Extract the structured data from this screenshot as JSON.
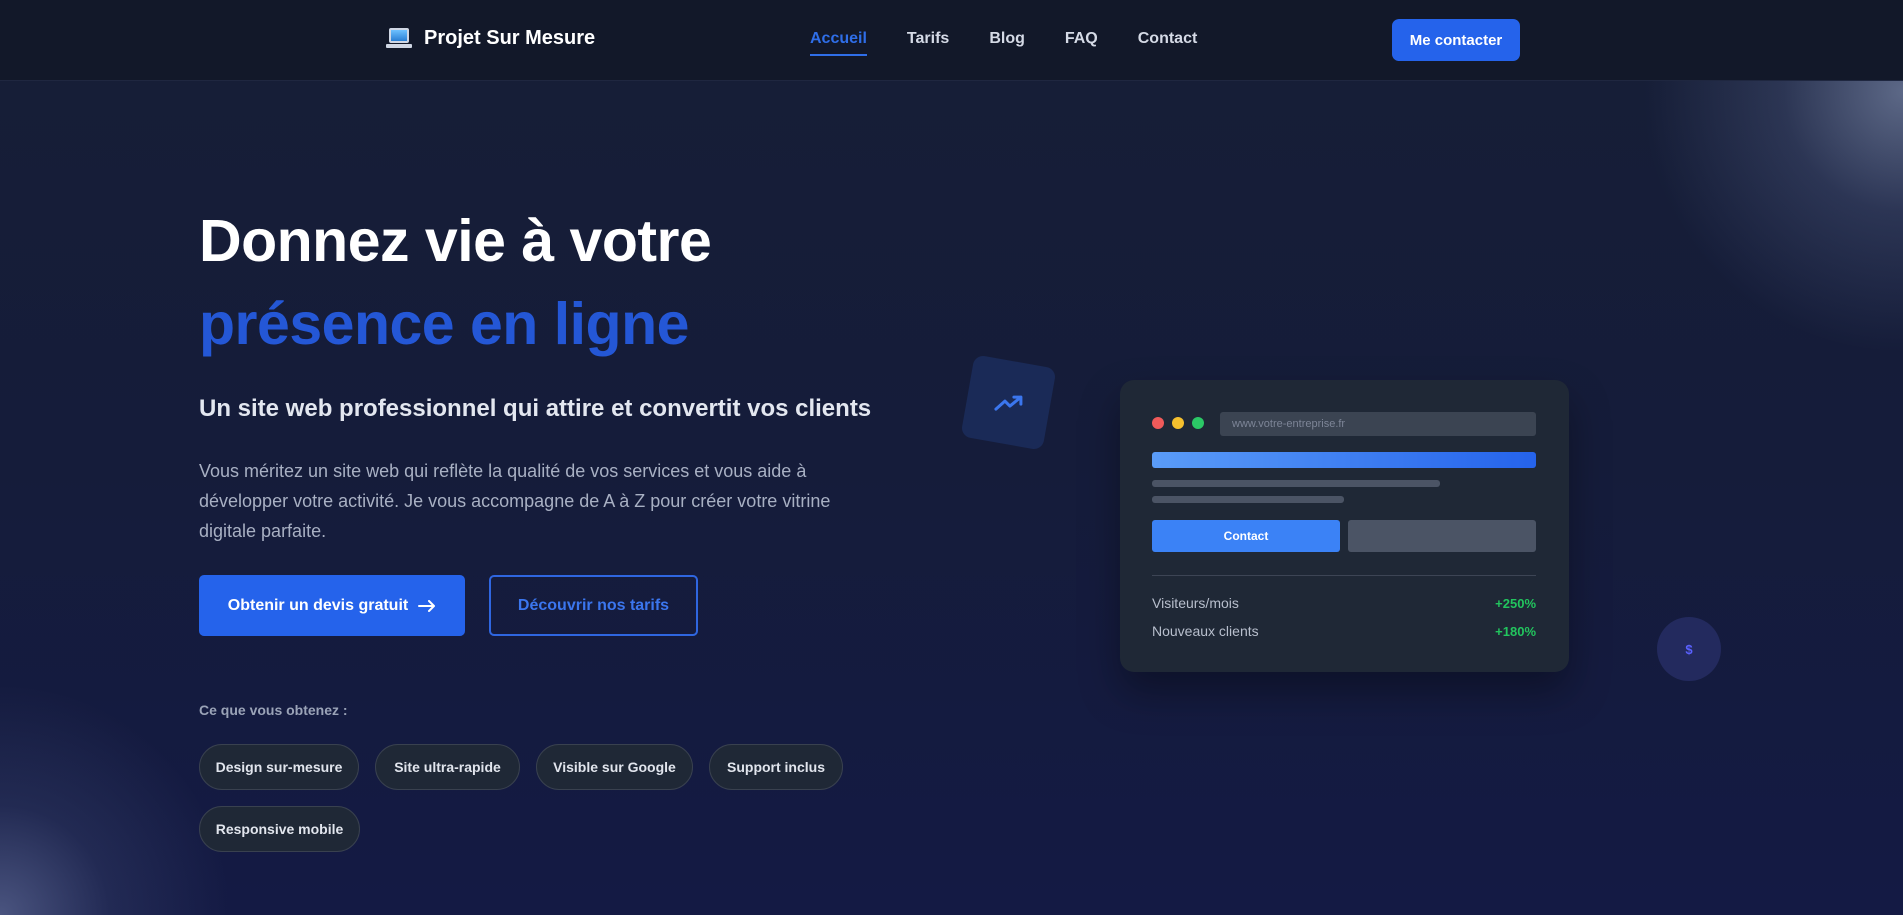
{
  "brand": {
    "name": "Projet Sur Mesure",
    "icon": "laptop-icon"
  },
  "nav": {
    "items": [
      {
        "label": "Accueil",
        "active": true
      },
      {
        "label": "Tarifs",
        "active": false
      },
      {
        "label": "Blog",
        "active": false
      },
      {
        "label": "FAQ",
        "active": false
      },
      {
        "label": "Contact",
        "active": false
      }
    ],
    "cta_label": "Me contacter"
  },
  "hero": {
    "title_line1": "Donnez vie à votre",
    "title_line2": "présence en ligne",
    "subtitle": "Un site web professionnel qui attire et convertit vos clients",
    "description": "Vous méritez un site web qui reflète la qualité de vos services et vous aide à développer votre activité. Je vous accompagne de A à Z pour créer votre vitrine digitale parfaite.",
    "primary_button": "Obtenir un devis gratuit",
    "primary_button_icon": "arrow-right-icon",
    "secondary_button": "Découvrir nos tarifs",
    "benefits_heading": "Ce que vous obtenez :",
    "benefits": [
      "Design sur-mesure",
      "Site ultra-rapide",
      "Visible sur Google",
      "Support inclus",
      "Responsive mobile"
    ]
  },
  "mockup": {
    "url": "www.votre-entreprise.fr",
    "button_label": "Contact",
    "stats": [
      {
        "label": "Visiteurs/mois",
        "value": "+250%"
      },
      {
        "label": "Nouveaux clients",
        "value": "+180%"
      }
    ]
  },
  "decorations": {
    "trend_icon": "trending-up-icon",
    "dollar_symbol": "$"
  },
  "colors": {
    "accent": "#2563eb",
    "title_highlight": "#2457d6",
    "success": "#22c55e",
    "header_bg": "#121829",
    "card_bg": "#1f2836"
  }
}
